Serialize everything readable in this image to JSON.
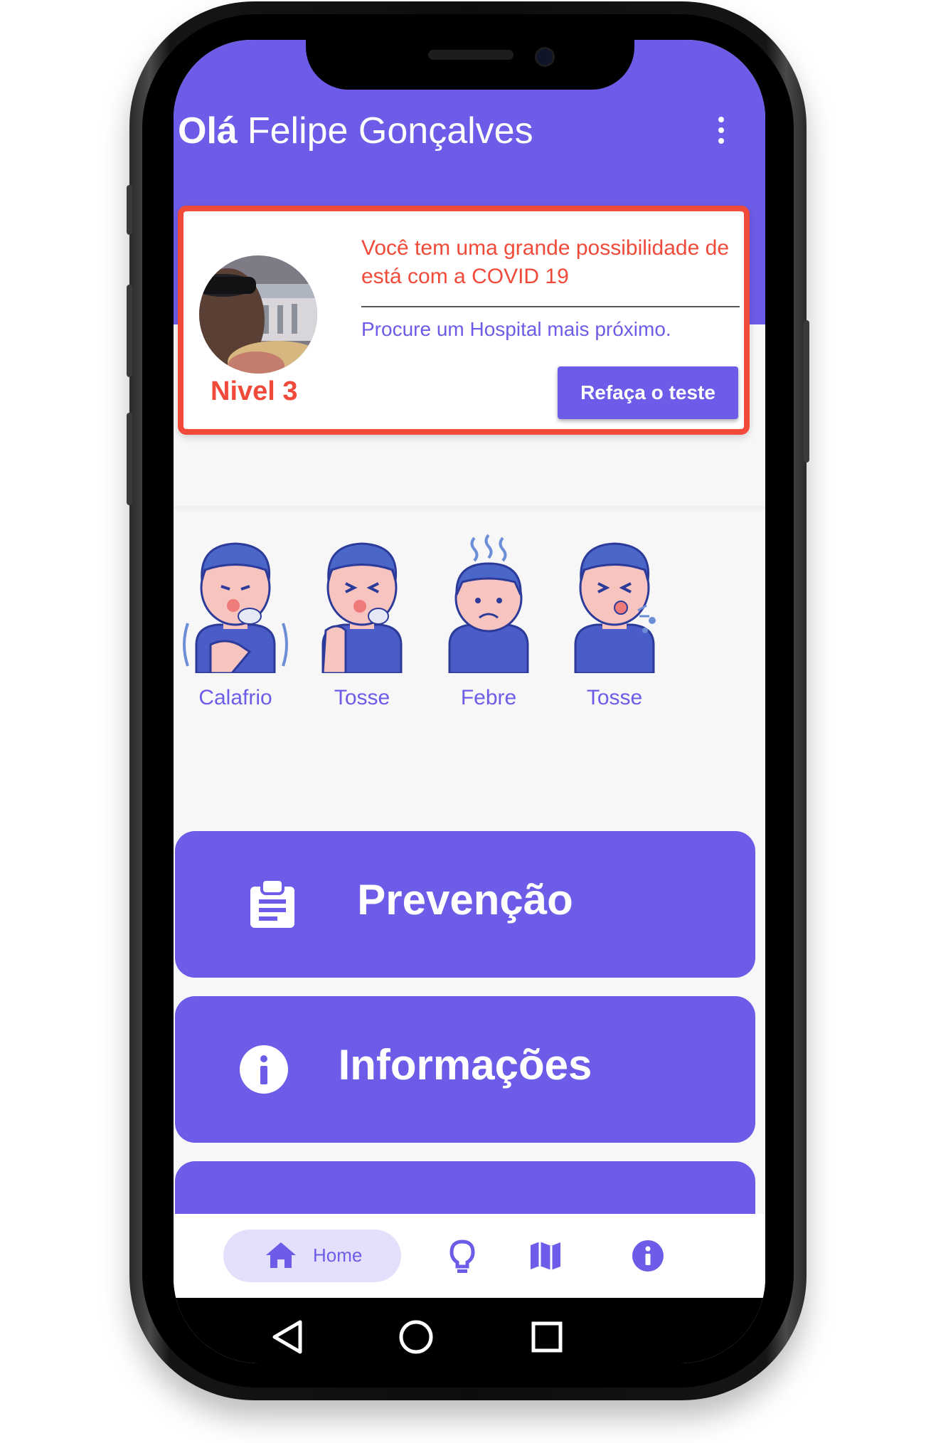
{
  "header": {
    "greeting": "Olá",
    "user_name": "Felipe Gonçalves",
    "menu_icon": "more-vert-icon"
  },
  "result_card": {
    "level": "Nivel 3",
    "message": "Você tem uma grande possibilidade de está com a COVID 19",
    "advice": "Procure um Hospital mais próximo.",
    "retest_label": "Refaça o teste",
    "accent_color": "#f04a3a"
  },
  "symptoms": [
    {
      "label": "Calafrio",
      "icon": "chills-icon"
    },
    {
      "label": "Tosse",
      "icon": "cough-icon"
    },
    {
      "label": "Febre",
      "icon": "fever-icon"
    },
    {
      "label": "Tosse",
      "icon": "cough-icon"
    }
  ],
  "menu_buttons": [
    {
      "label": "Prevenção",
      "icon": "clipboard-icon"
    },
    {
      "label": "Informações",
      "icon": "info-icon"
    }
  ],
  "bottom_nav": {
    "home_label": "Home",
    "items": [
      "home-icon",
      "lightbulb-icon",
      "map-icon",
      "info-icon"
    ]
  },
  "theme": {
    "primary": "#6c5ce7",
    "nav_highlight": "#e4e0fb"
  }
}
